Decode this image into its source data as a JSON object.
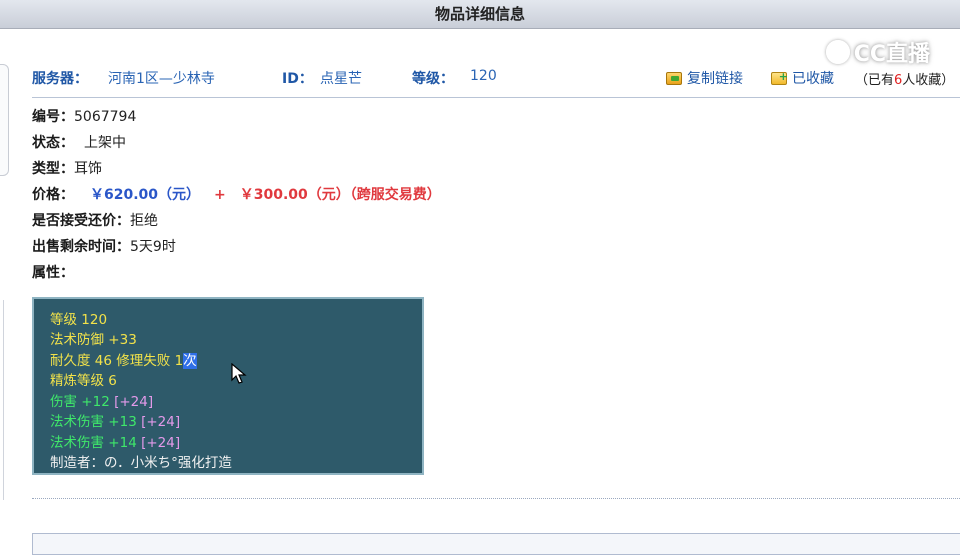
{
  "window": {
    "title": "物品详细信息"
  },
  "watermark": {
    "text": "CC直播"
  },
  "header": {
    "server_label": "服务器：",
    "server_value": "河南1区—少林寺",
    "id_label": "ID：",
    "id_value": "点星芒",
    "level_label": "等级：",
    "level_value": "120",
    "copy_link": "复制链接",
    "favorited": "已收藏",
    "fav_prefix": "（已有",
    "fav_count": "6",
    "fav_suffix": "人收藏）",
    "icons": {
      "copy": "copy-link-icon",
      "favorite": "favorite-icon"
    }
  },
  "details": {
    "number_label": "编号：",
    "number_value": "5067794",
    "status_label": "状态：",
    "status_value": "上架中",
    "type_label": "类型：",
    "type_value": "耳饰",
    "price_label": "价格：",
    "price_value": "￥620.00（元）",
    "price_plus": "+",
    "price_fee": "￥300.00（元）（跨服交易费）",
    "bargain_label": "是否接受还价：",
    "bargain_value": "拒绝",
    "remaining_label": "出售剩余时间：",
    "remaining_value": "5天9时",
    "attributes_label": "属性："
  },
  "attributes": {
    "line1": "等级 120",
    "line2": "法术防御 +33",
    "line3a": "耐久度 46 修理失败 ",
    "line3b": "1",
    "line3c": "次",
    "line4": "精炼等级 6",
    "line5a": "伤害 +12 ",
    "line5b": "[+24]",
    "line6a": "法术伤害 +13 ",
    "line6b": "[+24]",
    "line7a": "法术伤害 +14 ",
    "line7b": "[+24]",
    "line8": "制造者：の．小米ち°强化打造"
  },
  "colors": {
    "label_blue": "#1f57a6",
    "price_blue": "#2a56c8",
    "price_red": "#e0393e",
    "attr_bg": "#2e5a6a",
    "attr_yellow": "#f2e24a",
    "attr_green": "#3fe86a",
    "attr_pink": "#e49aea"
  }
}
